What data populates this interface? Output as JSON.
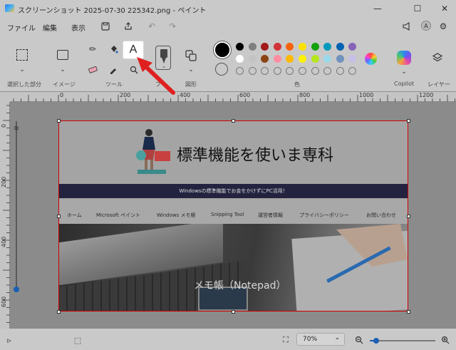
{
  "window": {
    "title": "スクリーンショット 2025-07-30 225342.png - ペイント",
    "minimize": "—",
    "maximize": "☐",
    "close": "✕"
  },
  "menu": {
    "file": "ファイル",
    "edit": "編集",
    "view": "表示",
    "avatar": "A"
  },
  "ribbon": {
    "groups": {
      "selection": "選択した部分",
      "image": "イメージ",
      "tools": "ツール",
      "brushes": "ブ",
      "shapes": "図形",
      "colors": "色",
      "copilot": "Copilot",
      "layers": "レイヤー"
    },
    "text_tool_glyph": "A",
    "swatches_row1": [
      "#000000",
      "#7f7f7f",
      "#a31a1a",
      "#d13438",
      "#f7630c",
      "#fce100",
      "#13a10e",
      "#0099bc",
      "#0063b1",
      "#8764b8"
    ],
    "swatches_row2": [
      "#ffffff",
      "#c3c3c3",
      "#8b4513",
      "#ff8da1",
      "#ffb900",
      "#fff100",
      "#b5e61d",
      "#99d9ea",
      "#7092be",
      "#c8bfe7"
    ]
  },
  "ruler": {
    "h_labels": [
      "0",
      "200",
      "400",
      "600",
      "800",
      "1000",
      "1200"
    ],
    "v_labels": [
      "0",
      "200",
      "400",
      "600"
    ]
  },
  "page": {
    "site_title": "標準機能を使いま専科",
    "banner": "Windowsの標準機能でお金をかけずにPC活用！",
    "nav": [
      "ホーム",
      "Microsoft ペイント",
      "Windows メモ帳",
      "Snipping Tool",
      "運営者情報",
      "プライバシーポリシー",
      "お問い合わせ"
    ],
    "hero_title": "メモ帳（Notepad）"
  },
  "status": {
    "zoom": "70%",
    "zoom_caret": "⌄",
    "zoom_level": 0.1
  },
  "colors": {
    "accent": "#1a5fb4",
    "arrow": "#e02020",
    "selection_border": "#cc0000"
  }
}
